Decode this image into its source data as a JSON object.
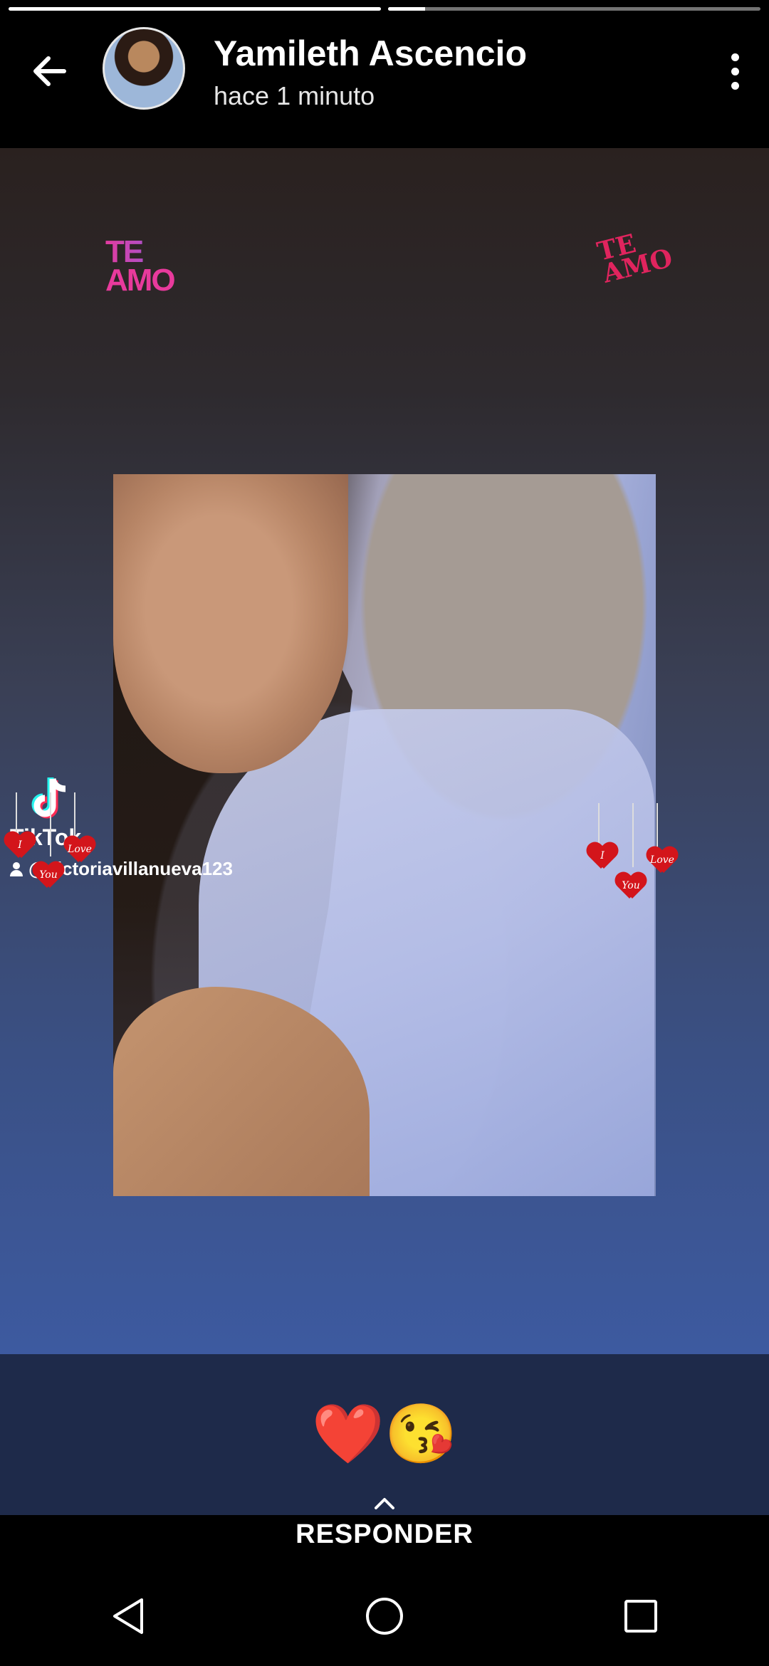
{
  "story": {
    "progress_segments": [
      1.0,
      0.1
    ],
    "author_name": "Yamileth Ascencio",
    "timestamp": "hace 1 minuto",
    "avatar_icon": "profile-photo",
    "stickers": {
      "te_amo_left_l1": "TE",
      "te_amo_left_l2": "AMO",
      "te_amo_right_l1": "TE",
      "te_amo_right_l2": "AMO"
    },
    "tiktok": {
      "brand": "TikTok",
      "username": "@victoriavillanueva123"
    },
    "hearts": {
      "left": [
        "I",
        "Love",
        "You"
      ],
      "right": [
        "I",
        "Love",
        "You"
      ]
    },
    "caption": "❤️😘"
  },
  "reply": {
    "label": "RESPONDER"
  },
  "navbar": {
    "back_icon": "triangle-back-icon",
    "home_icon": "circle-home-icon",
    "recents_icon": "square-recents-icon"
  },
  "colors": {
    "heart_red": "#d3151b",
    "pink": "#e83a9c",
    "caption_bg": "#1e2a4a"
  }
}
